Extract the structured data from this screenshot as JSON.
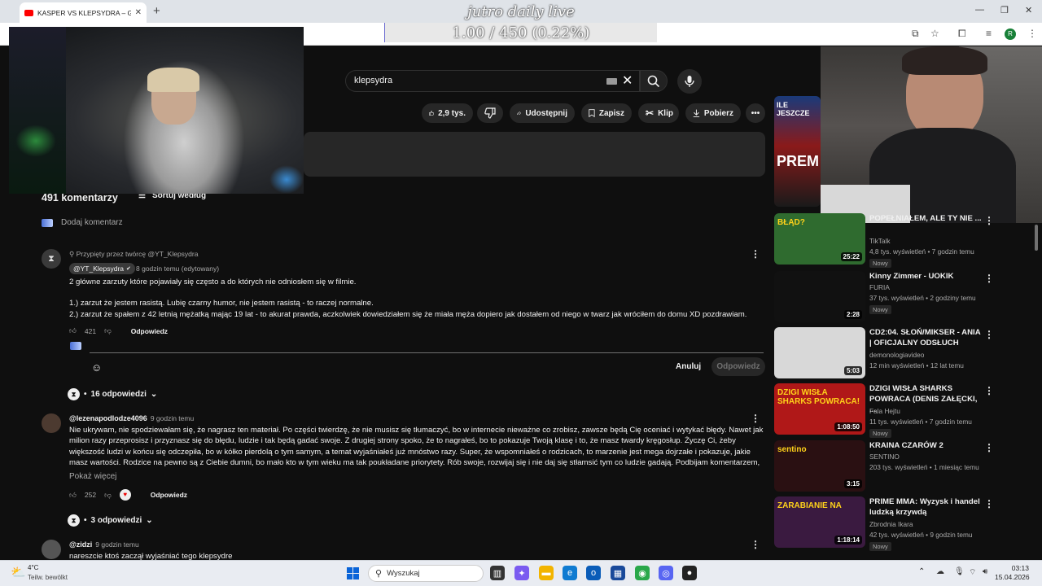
{
  "browser": {
    "tab_title": "KASPER VS KLEPSYDRA – GDZIE",
    "new_tab": "+",
    "profile_initial": "R"
  },
  "overlay": {
    "title": "jutro daily live",
    "goal": "1.00 / 450 (0.22%)"
  },
  "search": {
    "query": "klepsydra"
  },
  "actions": {
    "like_count": "2,9 tys.",
    "share": "Udostępnij",
    "save": "Zapisz",
    "clip": "Klip",
    "download": "Pobierz"
  },
  "comments": {
    "count": "491 komentarzy",
    "sort": "Sortuj według",
    "add_placeholder": "Dodaj komentarz",
    "pinned": {
      "pin_label": "Przypięty przez twórcę @YT_Klepsydra",
      "author": "@YT_Klepsydra",
      "time": "8 godzin temu (edytowany)",
      "line1": "2 główne zarzuty które pojawiały się często a do których nie odniosłem się w filmie.",
      "line2": "1.) zarzut że jestem rasistą. Lubię czarny humor, nie jestem rasistą - to raczej normalne.",
      "line3": "2.) zarzut że spałem z 42 letnią mężatką mając 19 lat - to akurat prawda, aczkolwiek dowiedziałem się że miała męża dopiero jak dostałem od niego w twarz jak wróciłem do domu XD pozdrawiam.",
      "likes": "421",
      "reply": "Odpowiedz",
      "cancel": "Anuluj",
      "submit": "Odpowiedz",
      "replies": "16 odpowiedzi"
    },
    "second": {
      "author": "@lezenapodlodze4096",
      "time": "9 godzin temu",
      "text": "Nie ukrywam, nie spodziewałam się, że nagrasz ten materiał. Po części twierdzę, że nie musisz się tłumaczyć, bo w internecie nieważne co zrobisz, zawsze będą Cię oceniać i wytykać błędy. Nawet jak milion razy przeprosisz i przyznasz się do błędu, ludzie i tak będą gadać swoje. Z drugiej strony spoko, że to nagrałeś, bo to pokazuje Twoją klasę i to, że masz twardy kręgosłup. Życzę Ci, żeby większość ludzi w końcu się odczepiła, bo w kółko pierdolą o tym samym, a temat wyjaśniałeś już mnóstwo razy. Super, że wspomniałeś o rodzicach, to marzenie jest mega dojrzałe i pokazuje, jakie masz wartości. Rodzice na pewno są z Ciebie dumni, bo mało kto w tym wieku ma tak poukładane priorytety. Rób swoje, rozwijaj się i nie daj się stłamsić tym co ludzie gadają. Podbijam komentarzem, jak zawsze i życzę przetrwania w...",
      "more": "Pokaż więcej",
      "likes": "252",
      "reply": "Odpowiedz",
      "replies": "3 odpowiedzi"
    },
    "third": {
      "author": "@zidzi",
      "time": "9 godzin temu",
      "text": "nareszcie ktoś zaczął wyjaśniać tego klepsydre"
    }
  },
  "recommendations": [
    {
      "title": "POPEŁNIAŁEM, ALE TY NIE ...",
      "channel": "TikTalk",
      "meta": "4,8 tys. wyświetleń • 7 godzin temu",
      "badge": "Nowy",
      "duration": "25:22",
      "thumb_text": "BŁĄD?",
      "color": "#2f6b2f"
    },
    {
      "title": "Kinny Zimmer - UOKIK",
      "channel": "FURIA",
      "meta": "37 tys. wyświetleń • 2 godziny temu",
      "badge": "Nowy",
      "duration": "2:28",
      "thumb_text": "",
      "color": "#111111"
    },
    {
      "title": "CD2:04. SŁOŃ/MIKSER - ANIA | OFICJALNY ODSŁUCH",
      "channel": "demonologiavideo",
      "meta": "12 min wyświetleń • 12 lat temu",
      "badge": "",
      "duration": "5:03",
      "thumb_text": "",
      "color": "#d8d8d8"
    },
    {
      "title": "DZIGI WISŁA SHARKS POWRACA (DENIS ZAŁĘCKI, ...",
      "channel": "Fala Hejtu",
      "meta": "11 tys. wyświetleń • 7 godzin temu",
      "badge": "Nowy",
      "duration": "1:08:50",
      "thumb_text": "DZIGI WISŁA SHARKS POWRACA!",
      "color": "#b01818"
    },
    {
      "title": "KRAINA CZARÓW 2",
      "channel": "SENTINO",
      "meta": "203 tys. wyświetleń • 1 miesiąc temu",
      "badge": "",
      "duration": "3:15",
      "thumb_text": "sentino",
      "color": "#2a1012"
    },
    {
      "title": "PRIME MMA: Wyzysk i handel ludzką krzywdą",
      "channel": "Zbrodnia Ikara",
      "meta": "42 tys. wyświetleń • 9 godzin temu",
      "badge": "Nowy",
      "duration": "1:18:14",
      "thumb_text": "ZARABIANIE NA",
      "color": "#3a1a40"
    }
  ],
  "rec_top": {
    "thumb_text_1": "ILE JESZCZE",
    "thumb_text_2": "PREM"
  },
  "taskbar": {
    "temp": "4°C",
    "weather": "Teilw. bewölkt",
    "search": "Wyszukaj",
    "time": "03:13",
    "date": "15.04.2026"
  },
  "colors": {
    "bg": "#0f0f0f",
    "chip": "#272727",
    "youtube_red": "#ff0000"
  }
}
